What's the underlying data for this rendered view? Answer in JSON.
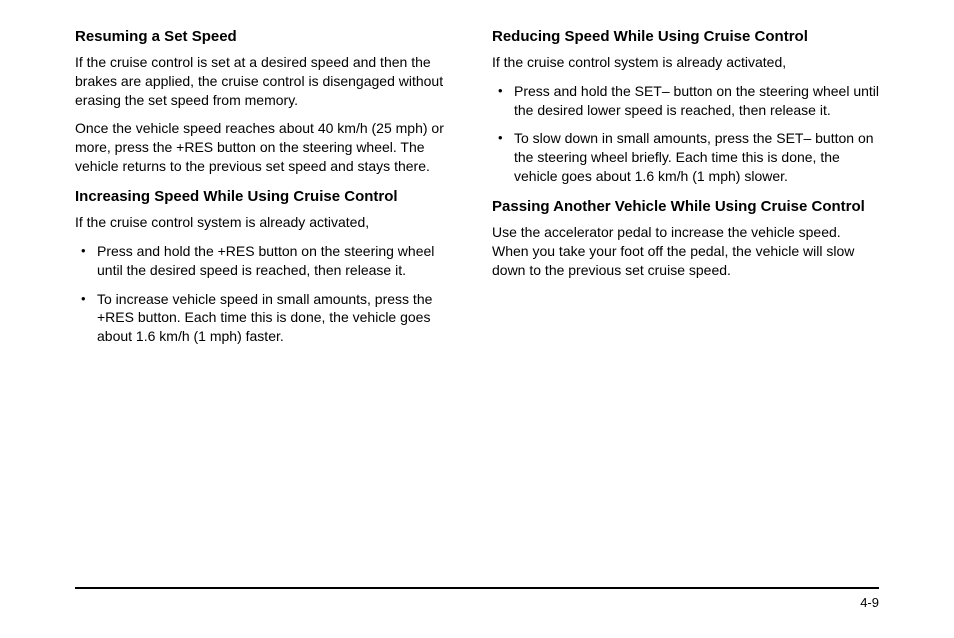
{
  "left": {
    "section1": {
      "heading": "Resuming a Set Speed",
      "para1": "If the cruise control is set at a desired speed and then the brakes are applied, the cruise control is disengaged without erasing the set speed from memory.",
      "para2": "Once the vehicle speed reaches about 40 km/h (25 mph) or more, press the +RES button on the steering wheel. The vehicle returns to the previous set speed and stays there."
    },
    "section2": {
      "heading": "Increasing Speed While Using Cruise Control",
      "intro": "If the cruise control system is already activated,",
      "bullets": [
        "Press and hold the +RES button on the steering wheel until the desired speed is reached, then release it.",
        "To increase vehicle speed in small amounts, press the +RES button. Each time this is done, the vehicle goes about 1.6 km/h (1 mph) faster."
      ]
    }
  },
  "right": {
    "section1": {
      "heading": "Reducing Speed While Using Cruise Control",
      "intro": "If the cruise control system is already activated,",
      "bullets": [
        "Press and hold the SET– button on the steering wheel until the desired lower speed is reached, then release it.",
        "To slow down in small amounts, press the SET– button on the steering wheel briefly. Each time this is done, the vehicle goes about 1.6 km/h (1 mph) slower."
      ]
    },
    "section2": {
      "heading": "Passing Another Vehicle While Using Cruise Control",
      "para": "Use the accelerator pedal to increase the vehicle speed. When you take your foot off the pedal, the vehicle will slow down to the previous set cruise speed."
    }
  },
  "pageNumber": "4-9"
}
